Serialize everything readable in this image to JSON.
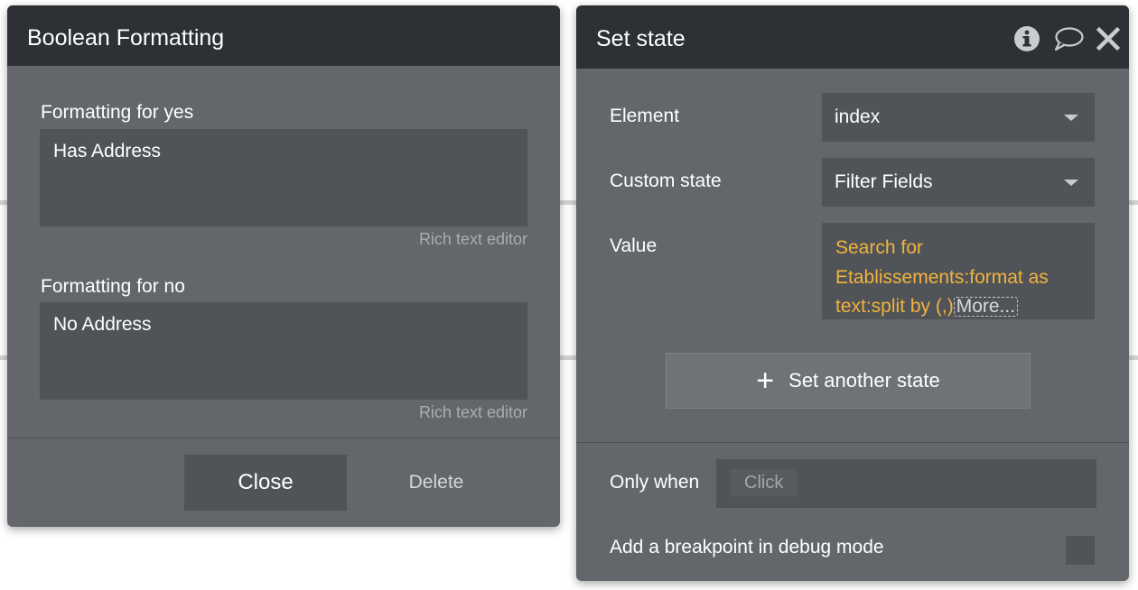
{
  "boolean_formatting": {
    "title": "Boolean Formatting",
    "yes_label": "Formatting for yes",
    "yes_value": "Has Address",
    "no_label": "Formatting for no",
    "no_value": "No Address",
    "rich_text_editor": "Rich text editor",
    "close_label": "Close",
    "delete_label": "Delete"
  },
  "set_state": {
    "title": "Set state",
    "icons": [
      "info-icon",
      "comment-icon",
      "close-icon"
    ],
    "element_label": "Element",
    "element_value": "index",
    "custom_state_label": "Custom state",
    "custom_state_value": "Filter Fields",
    "value_label": "Value",
    "value_text": "Search for Etablissements:format as text:split by (,)",
    "more_label": "More...",
    "set_another_label": "Set another state",
    "only_when_label": "Only when",
    "only_when_placeholder": "Click",
    "breakpoint_label": "Add a breakpoint in debug mode",
    "breakpoint_checked": false
  },
  "colors": {
    "header_bg": "#2d3034",
    "panel_bg": "#63676b",
    "field_bg": "#505458",
    "dynamic_expression": "#f2b33d"
  }
}
